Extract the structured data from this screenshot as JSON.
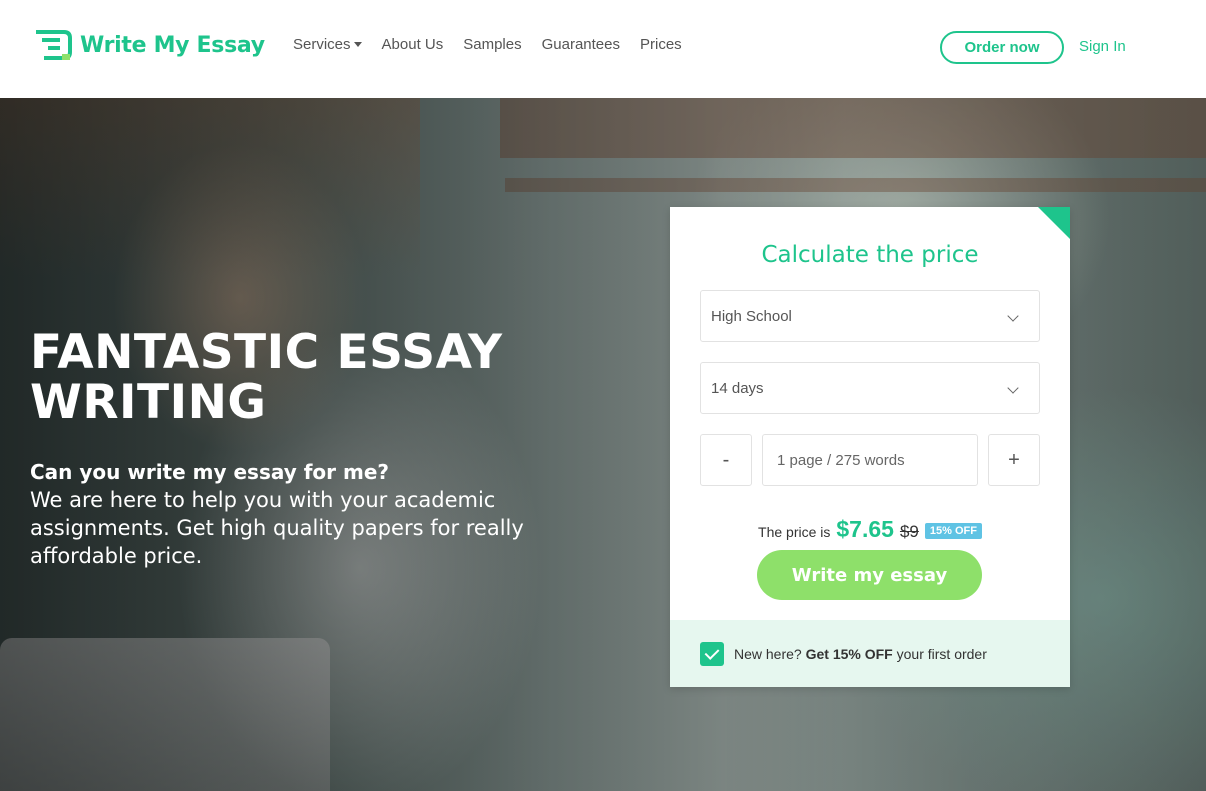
{
  "brand": {
    "name": "Write My Essay",
    "accent": "#1ec48c"
  },
  "nav": {
    "items": [
      {
        "label": "Services",
        "has_dropdown": true
      },
      {
        "label": "About Us"
      },
      {
        "label": "Samples"
      },
      {
        "label": "Guarantees"
      },
      {
        "label": "Prices"
      }
    ],
    "order_label": "Order now",
    "signin_label": "Sign In"
  },
  "hero": {
    "title": "FANTASTIC ESSAY WRITING",
    "question": "Can you write my essay for me?",
    "description": "We are here to help you with your academic assignments. Get high quality papers for really affordable price."
  },
  "calculator": {
    "title": "Calculate the price",
    "level": "High School",
    "deadline": "14 days",
    "minus": "-",
    "plus": "+",
    "pages": "1 page / 275 words",
    "price_label": "The price is",
    "price_now": "$7.65",
    "price_old": "$9",
    "discount": "15% OFF",
    "cta": "Write my essay",
    "promo_prefix": "New here?",
    "promo_bold": "Get 15% OFF",
    "promo_suffix": "your first order",
    "promo_checked": true
  }
}
